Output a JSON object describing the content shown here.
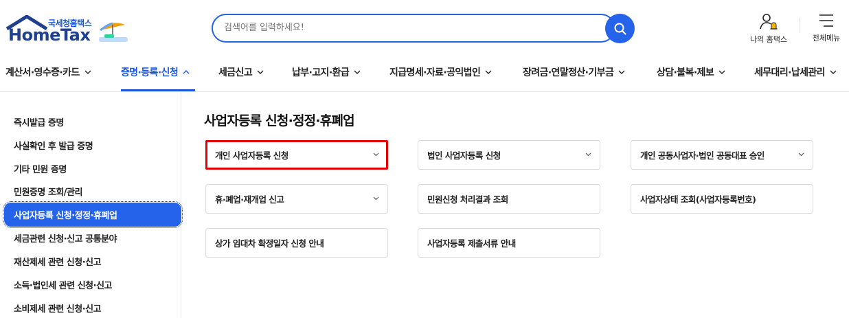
{
  "header": {
    "logo_sub": "국세청홈택스",
    "logo_main": "HomeTax",
    "search_placeholder": "검색어를 입력하세요!",
    "my_hometax": "나의 홈택스",
    "all_menu": "전체메뉴",
    "search_icon": "search-icon",
    "user_bell_icon": "user-bell-icon",
    "menu_icon": "hamburger-menu-icon"
  },
  "nav": {
    "items": [
      {
        "label": "계산서·영수증·카드"
      },
      {
        "label": "증명·등록·신청"
      },
      {
        "label": "세금신고"
      },
      {
        "label": "납부·고지·환급"
      },
      {
        "label": "지급명세·자료·공익법인"
      },
      {
        "label": "장려금·연말정산·기부금"
      },
      {
        "label": "상담·불복·제보"
      },
      {
        "label": "세무대리·납세관리"
      }
    ],
    "active_index": 1
  },
  "sidebar": {
    "items": [
      {
        "label": "즉시발급 증명"
      },
      {
        "label": "사실확인 후 발급 증명"
      },
      {
        "label": "기타 민원 증명"
      },
      {
        "label": "민원증명 조회/관리"
      },
      {
        "label": "사업자등록 신청·정정·휴폐업"
      },
      {
        "label": "세금관련 신청·신고 공통분야"
      },
      {
        "label": "재산제세 관련 신청·신고"
      },
      {
        "label": "소득·법인세 관련 신청·신고"
      },
      {
        "label": "소비제세 관련 신청·신고"
      }
    ],
    "active_index": 4
  },
  "main": {
    "title": "사업자등록 신청·정정·휴폐업",
    "cards": [
      {
        "label": "개인 사업자등록 신청",
        "expandable": true,
        "highlighted": true
      },
      {
        "label": "법인 사업자등록 신청",
        "expandable": true
      },
      {
        "label": "개인 공동사업자·법인 공동대표 승인",
        "expandable": true
      },
      {
        "label": "휴·폐업·재개업 신고",
        "expandable": true
      },
      {
        "label": "민원신청 처리결과 조회",
        "expandable": false
      },
      {
        "label": "사업자상태 조회(사업자등록번호)",
        "expandable": false
      },
      {
        "label": "상가 임대차 확정일자 신청 안내",
        "expandable": false
      },
      {
        "label": "사업자등록 제출서류 안내",
        "expandable": false
      }
    ]
  },
  "colors": {
    "accent": "#2563eb",
    "active_text": "#1a56db",
    "highlight_border": "#e00000"
  }
}
